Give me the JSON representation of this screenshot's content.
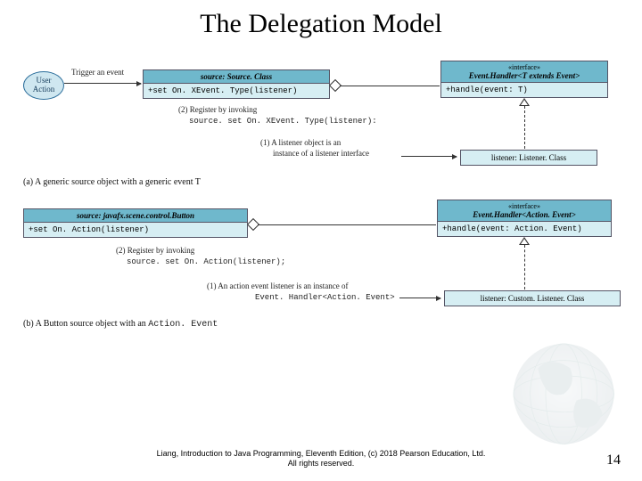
{
  "title": "The Delegation Model",
  "user_action_label": "User\nAction",
  "trigger_label": "Trigger an event",
  "top": {
    "source": {
      "head": "source: Source. Class",
      "body": "+set On. XEvent. Type(listener)"
    },
    "interface": {
      "stereo": "«interface»",
      "name": "Event.Handler<T extends Event>",
      "body": "+handle(event: T)"
    },
    "listener": "listener: Listener. Class",
    "reg_label": "(2) Register by invoking",
    "reg_code": "source. set On. XEvent. Type(listener):",
    "inst_label_1": "(1) A listener object is an",
    "inst_label_2": "instance of a listener interface",
    "caption": "(a) A generic source object with a generic event T"
  },
  "bottom": {
    "source": {
      "head": "source: javafx.scene.control.Button",
      "body": "+set On. Action(listener)"
    },
    "interface": {
      "stereo": "«interface»",
      "name": "Event.Handler<Action. Event>",
      "body": "+handle(event: Action. Event)"
    },
    "listener": "listener: Custom. Listener. Class",
    "reg_label": "(2) Register by invoking",
    "reg_code": "source. set On. Action(listener);",
    "inst_label_1": "(1) An action event listener is an instance of",
    "inst_code": "Event. Handler<Action. Event>",
    "caption_prefix": "(b) A Button source object with an ",
    "caption_code": "Action. Event"
  },
  "footer_line1": "Liang, Introduction to Java Programming, Eleventh Edition, (c) 2018 Pearson Education, Ltd.",
  "footer_line2": "All rights reserved.",
  "page_number": "14"
}
